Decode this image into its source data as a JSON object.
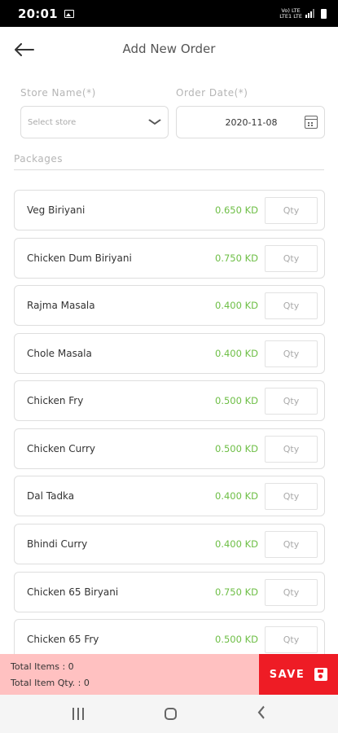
{
  "status_bar": {
    "time": "20:01",
    "network_top": "Vo) LTE",
    "network_bottom": "LTE1 LTE"
  },
  "header": {
    "title": "Add New Order",
    "back_icon": "back-arrow-icon"
  },
  "form": {
    "store_label": "Store Name(*)",
    "store_placeholder": "Select store",
    "date_label": "Order Date(*)",
    "date_value": "2020-11-08"
  },
  "packages": {
    "heading": "Packages",
    "qty_placeholder": "Qty",
    "items": [
      {
        "name": "Veg Biriyani",
        "price": "0.650 KD"
      },
      {
        "name": "Chicken Dum Biriyani",
        "price": "0.750 KD"
      },
      {
        "name": "Rajma Masala",
        "price": "0.400 KD"
      },
      {
        "name": "Chole Masala",
        "price": "0.400 KD"
      },
      {
        "name": "Chicken Fry",
        "price": "0.500 KD"
      },
      {
        "name": "Chicken Curry",
        "price": "0.500 KD"
      },
      {
        "name": "Dal Tadka",
        "price": "0.400 KD"
      },
      {
        "name": "Bhindi Curry",
        "price": "0.400 KD"
      },
      {
        "name": "Chicken 65 Biryani",
        "price": "0.750 KD"
      },
      {
        "name": "Chicken 65 Fry",
        "price": "0.500 KD"
      }
    ]
  },
  "footer": {
    "total_items": "Total Items : 0",
    "total_qty": "Total Item Qty. : 0",
    "save_label": "SAVE"
  },
  "colors": {
    "accent": "#ee1c25",
    "totals_bg": "#ffc1c1",
    "price": "#6dbe45"
  }
}
